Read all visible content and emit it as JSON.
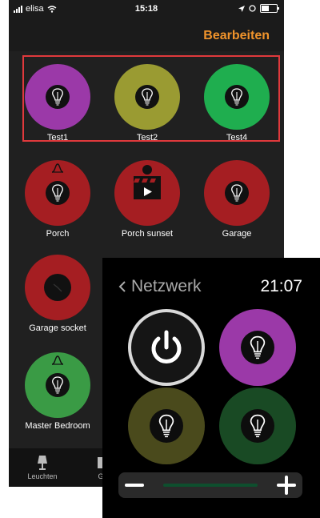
{
  "status_bar": {
    "carrier": "elisa",
    "time": "15:18"
  },
  "header": {
    "edit_label": "Bearbeiten"
  },
  "lamps": [
    {
      "label": "Test1",
      "color": "#9b39a8"
    },
    {
      "label": "Test2",
      "color": "#9a9b32"
    },
    {
      "label": "Test4",
      "color": "#1fae4f"
    },
    {
      "label": "Porch",
      "color": "#a51e22"
    },
    {
      "label": "Porch sunset",
      "color": "#a51e22"
    },
    {
      "label": "Garage",
      "color": "#a51e22"
    },
    {
      "label": "Garage socket",
      "color": "#a51e22"
    },
    {
      "label": "Master Bedroom",
      "color": "#3a9b45"
    }
  ],
  "tabbar": {
    "items": [
      {
        "label": "Leuchten",
        "icon": "lamp-icon"
      },
      {
        "label": "G",
        "icon": "groups-icon"
      }
    ]
  },
  "watch": {
    "back_label": "Netzwerk",
    "time": "21:07",
    "buttons": [
      {
        "icon": "power-icon",
        "color": "#d9d9d9"
      },
      {
        "icon": "bulb-icon",
        "color": "#9b39a8"
      },
      {
        "icon": "bulb-icon",
        "color": "#4a4a1c"
      },
      {
        "icon": "bulb-icon",
        "color": "#194a24"
      }
    ],
    "brightness": 0.0
  }
}
